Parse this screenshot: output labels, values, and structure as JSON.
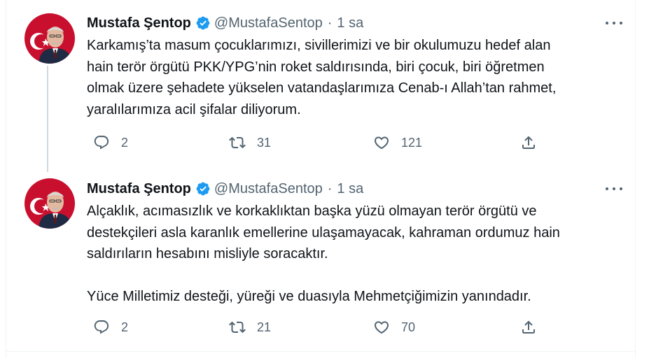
{
  "tweets": [
    {
      "author_name": "Mustafa Şentop",
      "handle": "@MustafaSentop",
      "separator": "·",
      "time": "1 sa",
      "text": "Karkamış’ta masum çocuklarımızı, sivillerimizi ve bir okulumuzu hedef alan\nhain terör örgütü PKK/YPG’nin roket saldırısında, biri çocuk, biri öğretmen\nolmak üzere şehadete yükselen vatandaşlarımıza Cenab-ı Allah’tan rahmet,\nyaralılarımıza acil şifalar diliyorum.",
      "replies": "2",
      "retweets": "31",
      "likes": "121"
    },
    {
      "author_name": "Mustafa Şentop",
      "handle": "@MustafaSentop",
      "separator": "·",
      "time": "1 sa",
      "text": "Alçaklık, acımasızlık ve korkaklıktan başka yüzü olmayan terör örgütü ve\ndestekçileri asla karanlık emellerine ulaşamayacak, kahraman ordumuz hain\nsaldırıların hesabını misliyle soracaktır.\n\nYüce Milletimiz desteği, yüreği ve duasıyla Mehmetçiğimizin yanındadır.",
      "replies": "2",
      "retweets": "21",
      "likes": "70"
    }
  ],
  "icons": {
    "verified": "verified-badge-icon",
    "more": "more-options-icon",
    "reply": "reply-icon",
    "retweet": "retweet-icon",
    "like": "like-icon",
    "share": "share-icon"
  },
  "colors": {
    "verified": "#1d9bf0",
    "secondary_text": "#536471",
    "primary_text": "#0f1419",
    "divider": "#eff3f4",
    "thread_line": "#cfd9de"
  }
}
